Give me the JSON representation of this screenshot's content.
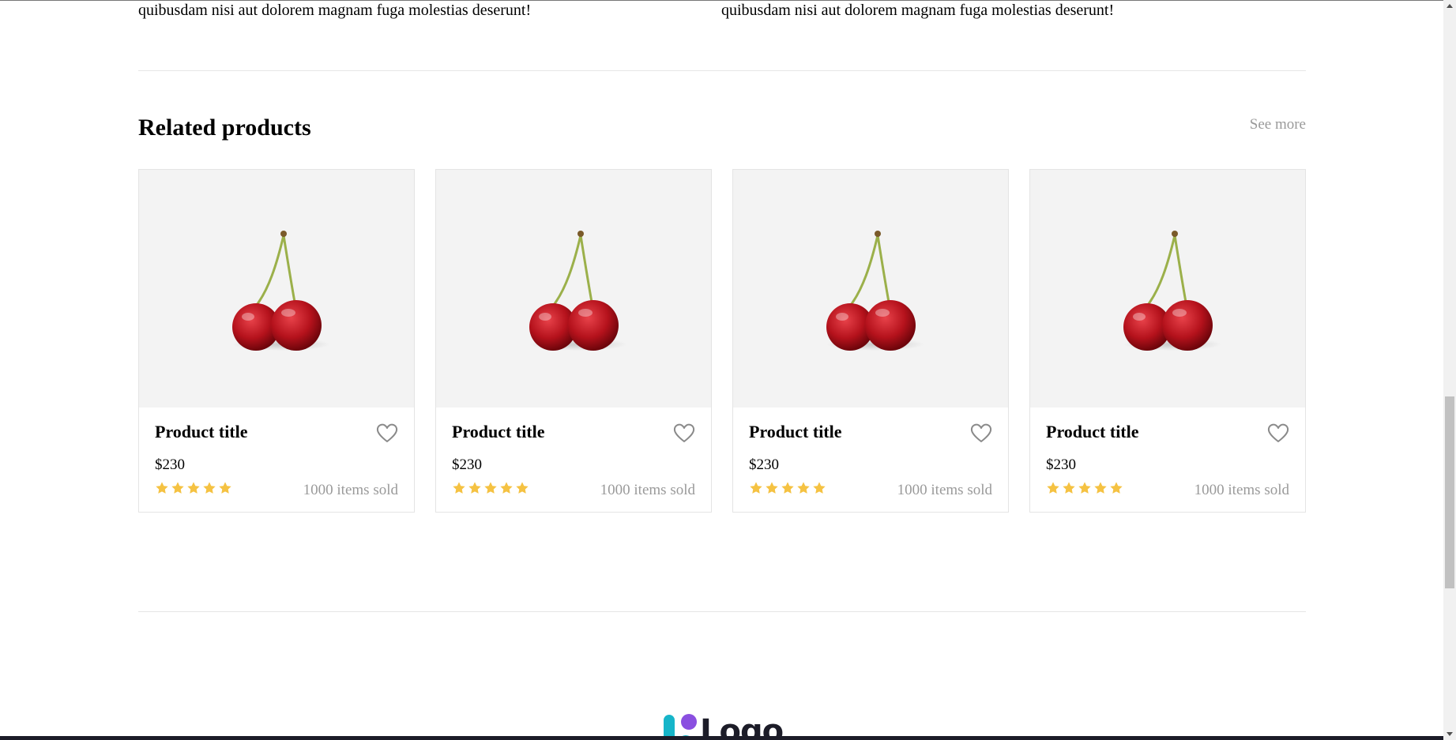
{
  "description": {
    "left_text": "quibusdam nisi aut dolorem magnam fuga molestias deserunt!",
    "right_text": "quibusdam nisi aut dolorem magnam fuga molestias deserunt!"
  },
  "related": {
    "title": "Related products",
    "see_more": "See more",
    "products": [
      {
        "title": "Product title",
        "price": "$230",
        "sold": "1000 items sold",
        "rating": 5
      },
      {
        "title": "Product title",
        "price": "$230",
        "sold": "1000 items sold",
        "rating": 5
      },
      {
        "title": "Product title",
        "price": "$230",
        "sold": "1000 items sold",
        "rating": 5
      },
      {
        "title": "Product title",
        "price": "$230",
        "sold": "1000 items sold",
        "rating": 5
      }
    ]
  },
  "footer": {
    "logo_text": "Logo"
  },
  "colors": {
    "star": "#f5c242",
    "muted": "#9a9a9a",
    "image_bg": "#f3f3f3",
    "logo_teal": "#16b5c9",
    "logo_purple": "#8a4fe0"
  },
  "icons": {
    "favorite": "heart-outline-icon",
    "rating": "star-icon",
    "product_image": "cherry-image"
  }
}
